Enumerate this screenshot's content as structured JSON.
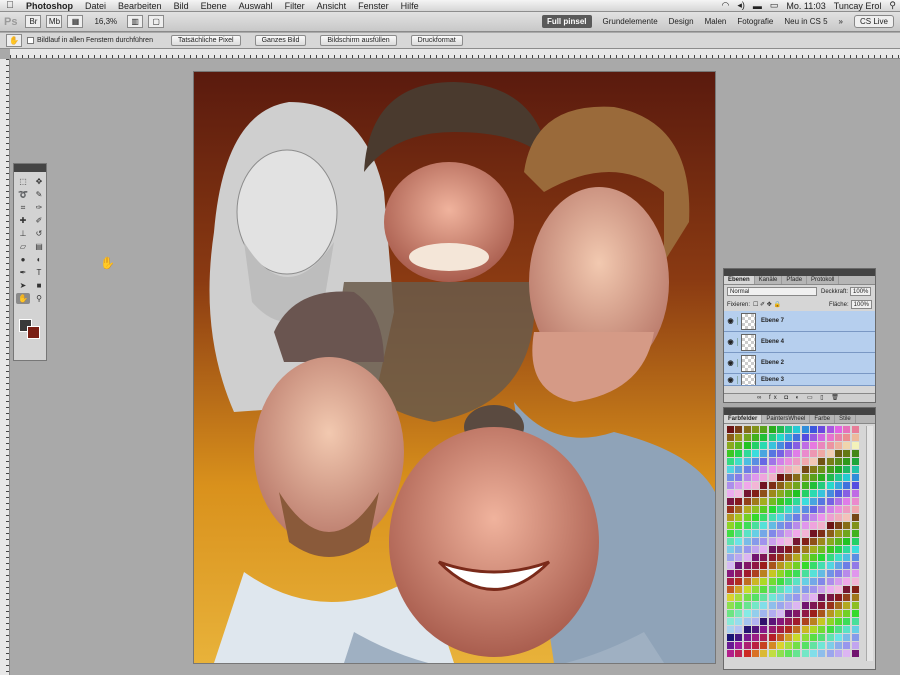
{
  "menubar": {
    "apple": "",
    "items": [
      "Photoshop",
      "Datei",
      "Bearbeiten",
      "Bild",
      "Ebene",
      "Auswahl",
      "Filter",
      "Ansicht",
      "Fenster",
      "Hilfe"
    ],
    "clock": "Mo. 11:03",
    "user": "Tuncay Erol"
  },
  "appbar": {
    "logo": "Ps",
    "zoom": "16,3%",
    "workspaces": [
      "Full pinsel",
      "Grundelemente",
      "Design",
      "Malen",
      "Fotografie",
      "Neu in CS 5"
    ],
    "more": "»",
    "cslive": "CS Live"
  },
  "options": {
    "scroll_all": "Bildlauf in allen Fenstern durchführen",
    "buttons": [
      "Tatsächliche Pixel",
      "Ganzes Bild",
      "Bildschirm ausfüllen",
      "Druckformat"
    ]
  },
  "layers": {
    "tabs": [
      "Ebenen",
      "Kanäle",
      "Pfade",
      "Protokoll"
    ],
    "blend_mode": "Normal",
    "opacity_label": "Deckkraft:",
    "opacity": "100%",
    "lock_label": "Fixieren:",
    "fill_label": "Fläche:",
    "fill": "100%",
    "items": [
      "Ebene 7",
      "Ebene 4",
      "Ebene 2",
      "Ebene 3"
    ]
  },
  "swatches": {
    "tabs": [
      "Farbfelder",
      "PaintersWheel",
      "Farbe",
      "Stile"
    ]
  },
  "colors": {
    "foreground": "#3a3a3a",
    "background": "#7a1f14",
    "layer_selected": "#b6cfee"
  }
}
